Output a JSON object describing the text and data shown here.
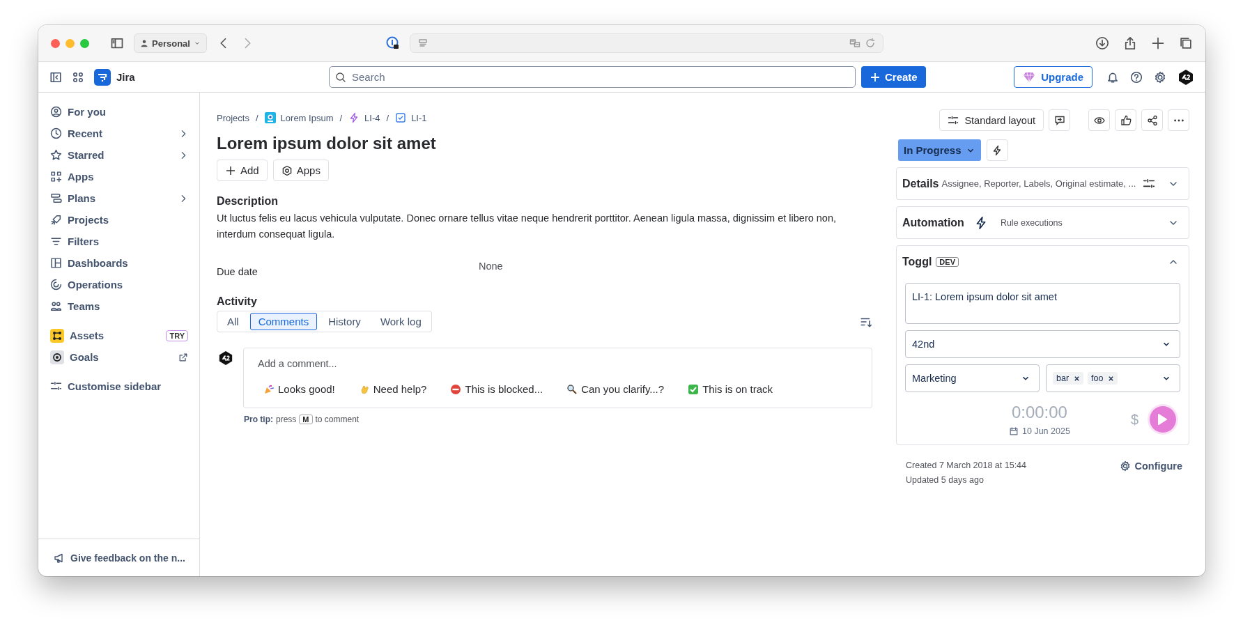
{
  "browser": {
    "profile": "Personal"
  },
  "header": {
    "app_name": "Jira",
    "search": {
      "placeholder": "Search"
    },
    "create_button": "Create",
    "upgrade_button": "Upgrade"
  },
  "sidebar": {
    "items": [
      {
        "label": "For you",
        "has_submenu": false
      },
      {
        "label": "Recent",
        "has_submenu": true
      },
      {
        "label": "Starred",
        "has_submenu": true
      },
      {
        "label": "Apps",
        "has_submenu": false
      },
      {
        "label": "Plans",
        "has_submenu": true
      },
      {
        "label": "Projects",
        "has_submenu": false
      },
      {
        "label": "Filters",
        "has_submenu": false
      },
      {
        "label": "Dashboards",
        "has_submenu": false
      },
      {
        "label": "Operations",
        "has_submenu": false
      },
      {
        "label": "Teams",
        "has_submenu": false
      }
    ],
    "apps": [
      {
        "label": "Assets",
        "badge": "TRY",
        "external": false
      },
      {
        "label": "Goals",
        "external": true
      }
    ],
    "customise": "Customise sidebar",
    "feedback": "Give feedback on the n..."
  },
  "breadcrumbs": {
    "separator": "/",
    "items": [
      {
        "label": "Projects"
      },
      {
        "label": "Lorem Ipsum"
      },
      {
        "label": "LI-4"
      },
      {
        "label": "LI-1"
      }
    ]
  },
  "issue": {
    "title": "Lorem ipsum dolor sit amet",
    "actions": [
      "Add",
      "Apps"
    ],
    "description_heading": "Description",
    "description": "Ut luctus felis eu lacus vehicula vulputate. Donec ornare tellus vitae neque hendrerit porttitor. Aenean ligula massa, dignissim et libero non, interdum consequat ligula.",
    "fields": [
      {
        "label": "Due date",
        "value": "None"
      }
    ]
  },
  "activity": {
    "heading": "Activity",
    "tabs": [
      {
        "label": "All",
        "selected": false
      },
      {
        "label": "Comments",
        "selected": true
      },
      {
        "label": "History",
        "selected": false
      },
      {
        "label": "Work log",
        "selected": false
      }
    ],
    "comment": {
      "placeholder": "Add a comment...",
      "quick_replies": [
        "Looks good!",
        "Need help?",
        "This is blocked...",
        "Can you clarify...?",
        "This is on track"
      ]
    },
    "pro_tip": {
      "label": "Pro tip:",
      "before": "press",
      "key": "M",
      "after": "to comment"
    }
  },
  "side": {
    "layout_button": "Standard layout",
    "status": "In Progress",
    "panels": [
      {
        "kind": "details",
        "title": "Details",
        "summary": "Assignee, Reporter, Labels, Original estimate, ...",
        "expanded": false
      },
      {
        "kind": "automation",
        "title": "Automation",
        "summary": "Rule executions",
        "expanded": false
      },
      {
        "kind": "toggl",
        "title": "Toggl",
        "badge": "DEV",
        "expanded": true
      }
    ],
    "toggl": {
      "description": "LI-1: Lorem ipsum dolor sit amet",
      "workspace": "42nd",
      "project": "Marketing",
      "tags": [
        "bar",
        "foo"
      ],
      "timer": "0:00:00",
      "date": "10 Jun 2025",
      "billable_label": "$",
      "billable": false
    },
    "created": "Created 7 March 2018 at 15:44",
    "updated": "Updated 5 days ago",
    "configure": "Configure"
  }
}
